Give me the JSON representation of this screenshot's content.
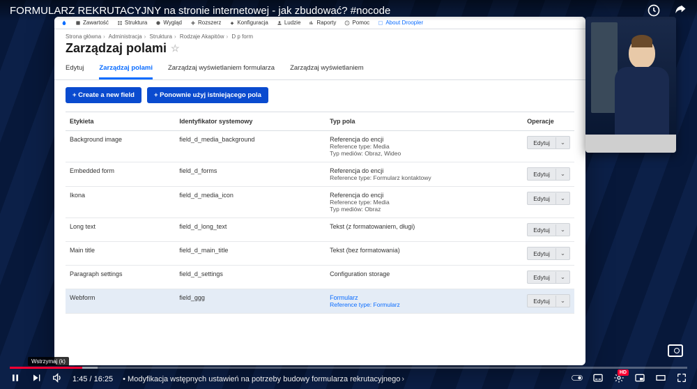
{
  "video": {
    "title": "FORMULARZ REKRUTACYJNY na stronie internetowej - jak zbudować? #nocode",
    "current_time": "1:45",
    "duration": "16:25",
    "chapter": "Modyfikacja wstępnych ustawień na potrzeby budowy formularza rekrutacyjnego",
    "tooltip": "Wstrzymaj (k)",
    "hd": "HD",
    "live": "•"
  },
  "admin_menu": {
    "items": [
      "Zawartość",
      "Struktura",
      "Wygląd",
      "Rozszerz",
      "Konfiguracja",
      "Ludzie",
      "Raporty",
      "Pomoc",
      "About Droopler"
    ]
  },
  "breadcrumbs": [
    "Strona główna",
    "Administracja",
    "Struktura",
    "Rodzaje Akapitów",
    "D p form"
  ],
  "page_title": "Zarządzaj polami",
  "tabs": [
    {
      "label": "Edytuj",
      "active": false
    },
    {
      "label": "Zarządzaj polami",
      "active": true
    },
    {
      "label": "Zarządzaj wyświetlaniem formularza",
      "active": false
    },
    {
      "label": "Zarządzaj wyświetlaniem",
      "active": false
    }
  ],
  "buttons": {
    "create": "+ Create a new field",
    "reuse": "+ Ponownie użyj istniejącego pola"
  },
  "table": {
    "headers": [
      "Etykieta",
      "Identyfikator systemowy",
      "Typ pola",
      "Operacje"
    ],
    "op_label": "Edytuj",
    "rows": [
      {
        "label": "Background image",
        "id": "field_d_media_background",
        "type": "Referencja do encji",
        "sub1": "Reference type: Media",
        "sub2": "Typ mediów: Obraz, Wideo"
      },
      {
        "label": "Embedded form",
        "id": "field_d_forms",
        "type": "Referencja do encji",
        "sub1": "Reference type: Formularz kontaktowy",
        "sub2": ""
      },
      {
        "label": "Ikona",
        "id": "field_d_media_icon",
        "type": "Referencja do encji",
        "sub1": "Reference type: Media",
        "sub2": "Typ mediów: Obraz"
      },
      {
        "label": "Long text",
        "id": "field_d_long_text",
        "type": "Tekst (z formatowaniem, długi)",
        "sub1": "",
        "sub2": ""
      },
      {
        "label": "Main title",
        "id": "field_d_main_title",
        "type": "Tekst (bez formatowania)",
        "sub1": "",
        "sub2": ""
      },
      {
        "label": "Paragraph settings",
        "id": "field_d_settings",
        "type": "Configuration storage",
        "sub1": "",
        "sub2": ""
      },
      {
        "label": "Webform",
        "id": "field_ggg",
        "type": "Formularz",
        "sub1": "Reference type: Formularz",
        "sub2": "",
        "link": true,
        "sel": true
      }
    ]
  }
}
